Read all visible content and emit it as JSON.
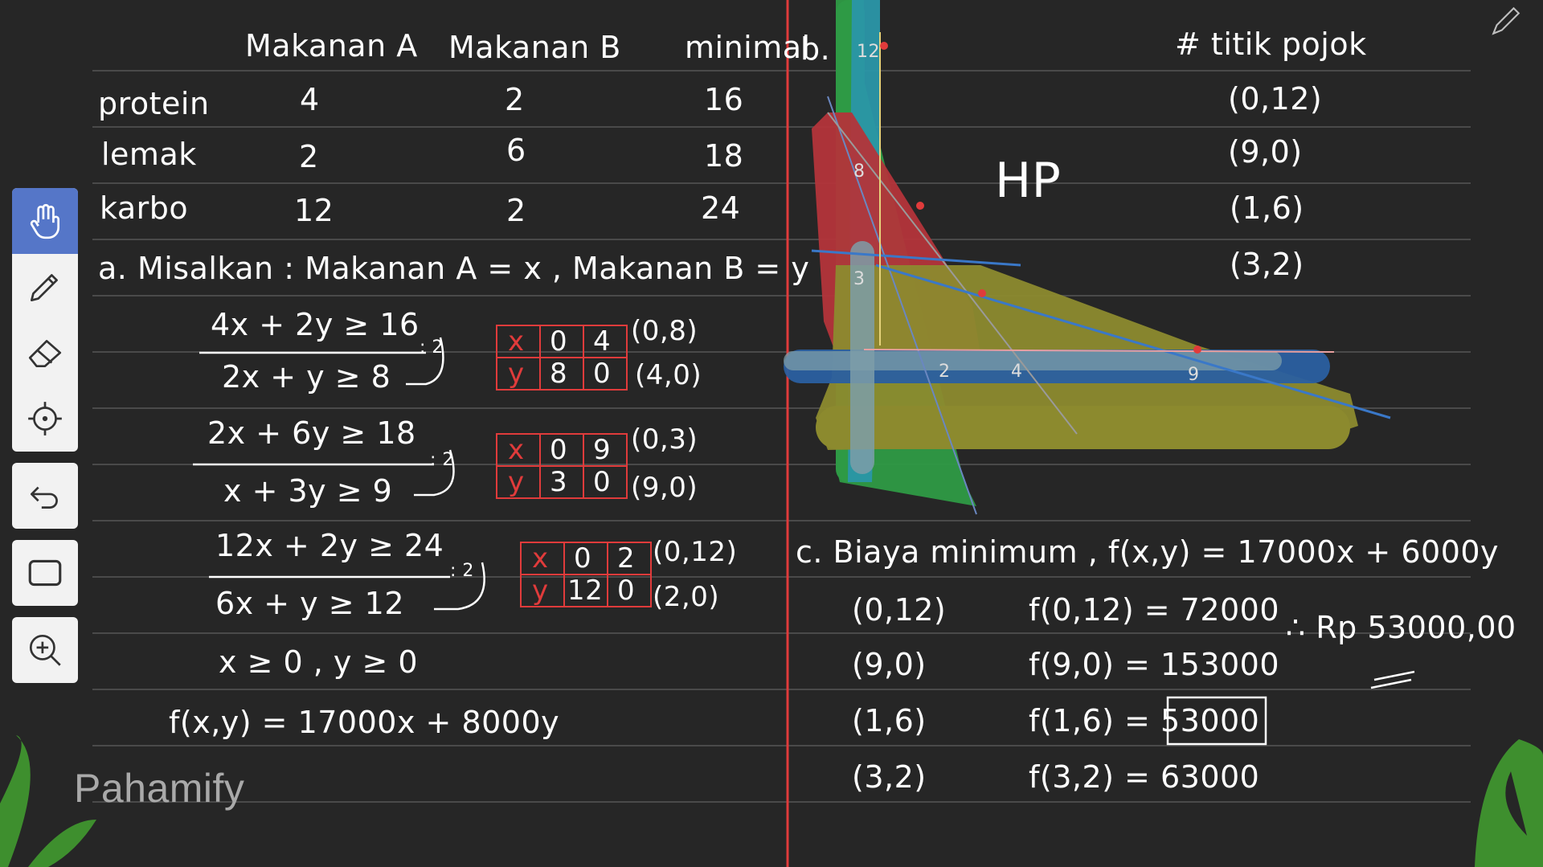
{
  "table": {
    "headers": [
      "Makanan A",
      "Makanan B",
      "minimal"
    ],
    "rows": [
      {
        "label": "protein",
        "a": "4",
        "b": "2",
        "min": "16"
      },
      {
        "label": "lemak",
        "a": "2",
        "b": "6",
        "min": "18"
      },
      {
        "label": "karbo",
        "a": "12",
        "b": "2",
        "min": "24"
      }
    ]
  },
  "part_a": {
    "intro": "a. Misalkan : Makanan A = x , Makanan B = y",
    "c1_orig": "4x + 2y ≥ 16",
    "c1_div": ": 2",
    "c1_simpl": "2x + y ≥ 8",
    "c1_tbl_x": [
      "x",
      "0",
      "4"
    ],
    "c1_tbl_y": [
      "y",
      "8",
      "0"
    ],
    "c1_pt1": "(0,8)",
    "c1_pt2": "(4,0)",
    "c2_orig": "2x + 6y ≥ 18",
    "c2_div": ": 2",
    "c2_simpl": "x + 3y ≥ 9",
    "c2_tbl_x": [
      "x",
      "0",
      "9"
    ],
    "c2_tbl_y": [
      "y",
      "3",
      "0"
    ],
    "c2_pt1": "(0,3)",
    "c2_pt2": "(9,0)",
    "c3_orig": "12x + 2y ≥ 24",
    "c3_div": ": 2",
    "c3_simpl": "6x + y ≥ 12",
    "c3_tbl_x": [
      "x",
      "0",
      "2"
    ],
    "c3_tbl_y": [
      "y",
      "12",
      "0"
    ],
    "c3_pt1": "(0,12)",
    "c3_pt2": "(2,0)",
    "nonneg": "x ≥ 0 , y ≥ 0",
    "objective": "f(x,y) = 17000x + 8000y"
  },
  "part_b": {
    "label": "b.",
    "hp": "HP",
    "tick_12": "12",
    "tick_8": "8",
    "tick_3": "3",
    "tick_x2": "2",
    "tick_x4": "4",
    "tick_x9": "9"
  },
  "corners": {
    "title": "# titik pojok",
    "points": [
      "(0,12)",
      "(9,0)",
      "(1,6)",
      "(3,2)"
    ]
  },
  "part_c": {
    "title": "c. Biaya minimum , f(x,y) = 17000x + 6000y",
    "rows": [
      {
        "pt": "(0,12)",
        "eval": "f(0,12) = 72000"
      },
      {
        "pt": "(9,0)",
        "eval": "f(9,0) = 153000"
      },
      {
        "pt": "(1,6)",
        "eval": "f(1,6) = 53000"
      },
      {
        "pt": "(3,2)",
        "eval": "f(3,2) = 63000"
      }
    ],
    "answer": "∴ Rp 53000,00"
  },
  "brand": "Pahamify",
  "colors": {
    "background": "#262626",
    "ink": "#ffffff",
    "red_line": "#e03b3b",
    "blue_line": "#3a78c8",
    "green_fill": "#2e9a45",
    "teal_fill": "#2a96a8",
    "red_fill": "#b3343a",
    "olive_fill": "#8c8a2e",
    "navy_fill": "#2a5fa0",
    "toolbar_active": "#5576c8"
  },
  "toolbar": {
    "tools": [
      "hand-icon",
      "pencil-icon",
      "eraser-icon",
      "target-icon",
      "undo-icon",
      "rectangle-icon",
      "zoom-in-icon"
    ]
  }
}
